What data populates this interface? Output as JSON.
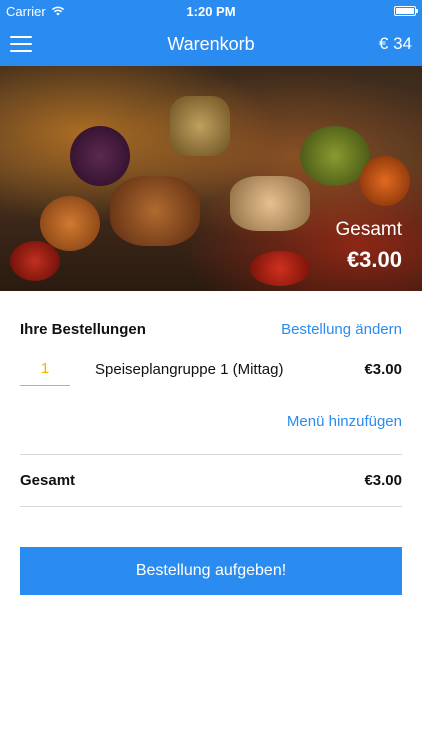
{
  "statusbar": {
    "carrier": "Carrier",
    "time": "1:20 PM"
  },
  "navbar": {
    "title": "Warenkorb",
    "balance": "€ 34"
  },
  "hero": {
    "total_label": "Gesamt",
    "total_value": "€3.00"
  },
  "orders": {
    "heading": "Ihre Bestellungen",
    "edit_link": "Bestellung ändern",
    "items": [
      {
        "quantity": "1",
        "name": "Speiseplangruppe 1 (Mittag)",
        "price": "€3.00"
      }
    ],
    "add_link": "Menü hinzufügen"
  },
  "summary": {
    "label": "Gesamt",
    "value": "€3.00"
  },
  "submit": {
    "label": "Bestellung aufgeben!"
  },
  "colors": {
    "accent": "#2a8cf0",
    "quantity": "#f0b400"
  },
  "icons": {
    "menu": "hamburger-menu-icon",
    "wifi": "wifi-icon",
    "battery": "battery-icon"
  }
}
